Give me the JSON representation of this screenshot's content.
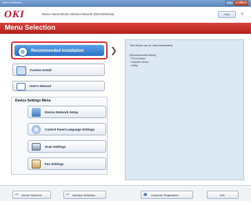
{
  "window": {
    "title": "Menu Selection"
  },
  "header": {
    "logo": "OKI",
    "device_info": "Device Name:MC3xx Interface:Network (DirectWireless)",
    "help_button": "Help"
  },
  "banner": {
    "title": "Menu Selection"
  },
  "main_buttons": {
    "recommended": "Recommended Installation",
    "custom": "Custom Install",
    "manual": "User's Manual"
  },
  "device_settings": {
    "title": "Device Settings Menu",
    "items": [
      {
        "label": "Device Network Setup",
        "icon": "network-icon"
      },
      {
        "label": "Control Panel Language Settings",
        "icon": "language-icon"
      },
      {
        "label": "Scan Settings",
        "icon": "scanner-icon"
      },
      {
        "label": "Fax Settings",
        "icon": "fax-icon"
      }
    ]
  },
  "info_panel": {
    "lines": [
      "This device can be used immediately.",
      "",
      "[Recommended Items]",
      "- PCL6 Driver",
      "- Scanner Driver",
      "- Utility"
    ]
  },
  "footer": {
    "device_selection": "Device Selection",
    "interface_selection": "Interface Selection",
    "customer_registration": "Customer Registration",
    "exit": "Exit"
  },
  "colors": {
    "brand_red": "#c8102e",
    "banner_red": "#c8302b",
    "selection_blue": "#2a71c6",
    "panel_bg": "#dce8f4"
  }
}
